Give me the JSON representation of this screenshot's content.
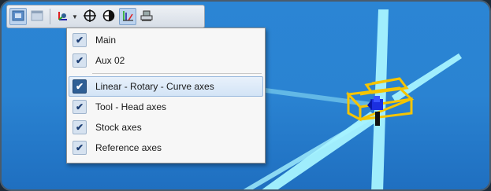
{
  "toolbar": {
    "buttons": [
      {
        "icon": "view-window-icon",
        "active": true
      },
      {
        "icon": "view-panel-icon",
        "active": false
      },
      {
        "icon": "axes-dropdown-icon",
        "active": false
      },
      {
        "icon": "crosshair-icon",
        "active": false
      },
      {
        "icon": "half-sphere-icon",
        "active": false
      },
      {
        "icon": "tool-vectors-icon",
        "active": true
      },
      {
        "icon": "machine-icon",
        "active": false
      }
    ]
  },
  "menu": {
    "items": [
      {
        "label": "Main",
        "checked": true,
        "highlight": false
      },
      {
        "label": "Aux 02",
        "checked": true,
        "highlight": false
      },
      {
        "label": "Linear - Rotary - Curve axes",
        "checked": true,
        "highlight": true
      },
      {
        "label": "Tool - Head axes",
        "checked": true,
        "highlight": false
      },
      {
        "label": "Stock axes",
        "checked": true,
        "highlight": false
      },
      {
        "label": "Reference axes",
        "checked": true,
        "highlight": false
      }
    ],
    "check_glyph": "✔"
  },
  "colors": {
    "viewport_top": "#2b85d4",
    "axis": "#a6f3ff",
    "stock_box": "#f5c400",
    "tool": "#1b2fe0"
  }
}
